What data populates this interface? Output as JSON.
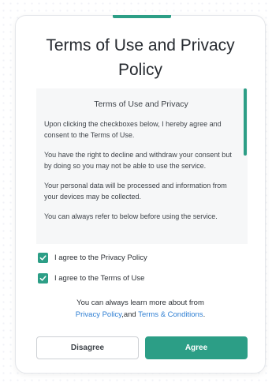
{
  "dialog": {
    "title": "Terms of Use and Privacy Policy"
  },
  "terms": {
    "heading": "Terms of Use and Privacy",
    "paragraphs": [
      "Upon clicking the checkboxes below, I hereby agree and consent to the Terms of Use.",
      "You have the right to decline and withdraw your consent but by doing so you may not be able to use the service.",
      "Your personal data will be processed and information from your devices may be collected.",
      "You can always refer to below before using the service."
    ]
  },
  "checkboxes": [
    {
      "label": "I agree to the Privacy Policy",
      "checked": true
    },
    {
      "label": "I agree to the Terms of Use",
      "checked": true
    }
  ],
  "learn_more": {
    "text": "You can always learn more about from",
    "privacy_link": "Privacy Policy",
    "joiner": ",and ",
    "terms_link": "Terms & Conditions",
    "end": "."
  },
  "buttons": {
    "disagree": "Disagree",
    "agree": "Agree"
  },
  "colors": {
    "accent": "#2c9e86",
    "link": "#2f7fd3"
  }
}
